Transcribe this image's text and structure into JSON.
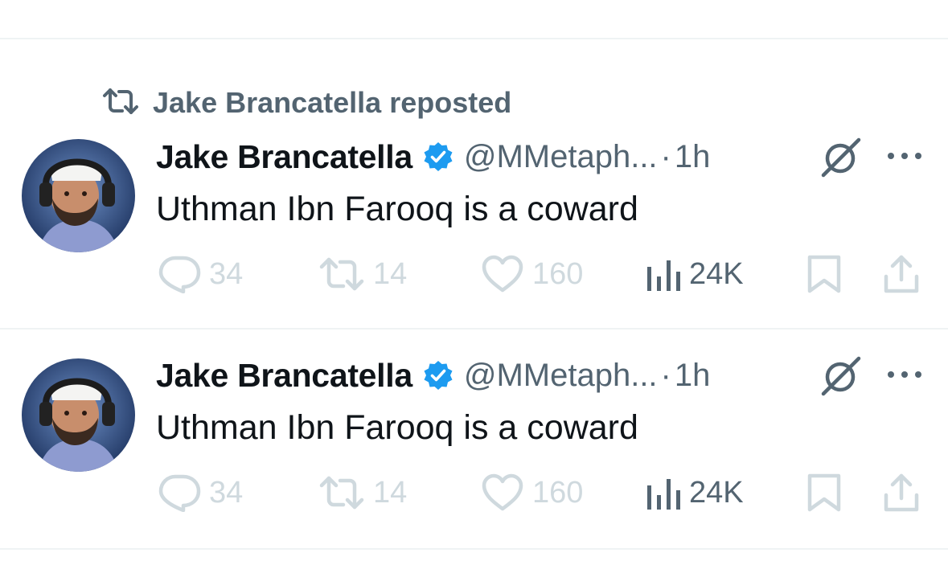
{
  "repost_banner": {
    "label": "Jake Brancatella reposted",
    "icon": "repost-icon"
  },
  "posts": [
    {
      "display_name": "Jake Brancatella",
      "verified": true,
      "handle": "@MMetaph...",
      "separator": "·",
      "time": "1h",
      "text": "Uthman Ibn Farooq is a coward",
      "replies": "34",
      "reposts": "14",
      "likes": "160",
      "views": "24K"
    },
    {
      "display_name": "Jake Brancatella",
      "verified": true,
      "handle": "@MMetaph...",
      "separator": "·",
      "time": "1h",
      "text": "Uthman Ibn Farooq is a coward",
      "replies": "34",
      "reposts": "14",
      "likes": "160",
      "views": "24K"
    }
  ],
  "colors": {
    "primary_text": "#0f1419",
    "secondary_text": "#536471",
    "muted_icon": "#cfd9de",
    "verified_blue": "#1d9bf0",
    "divider": "#eff3f4"
  }
}
